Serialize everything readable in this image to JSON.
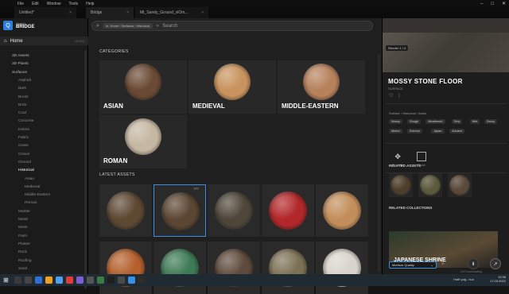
{
  "menu": [
    "File",
    "Edit",
    "Window",
    "Tools",
    "Help"
  ],
  "tabs": [
    {
      "label": "Untitled*",
      "close": "×"
    },
    {
      "label": "Bridge",
      "close": "×"
    },
    {
      "label": "Mt_Sandy_Ground_vlOm...",
      "close": "×"
    }
  ],
  "brand": {
    "line1": "Quixel",
    "line2": "BRIDGE",
    "icon": "Q"
  },
  "sidebar": {
    "home": "Home",
    "home_count": "15,833",
    "items": [
      {
        "label": "3D Assets",
        "level": "top"
      },
      {
        "label": "3D Plants",
        "level": "top"
      },
      {
        "label": "Surfaces",
        "level": "top-open"
      },
      {
        "label": "Asphalt",
        "level": "sub"
      },
      {
        "label": "Bark",
        "level": "sub"
      },
      {
        "label": "Brush",
        "level": "sub"
      },
      {
        "label": "Brick",
        "level": "sub"
      },
      {
        "label": "Coal",
        "level": "sub"
      },
      {
        "label": "Concrete",
        "level": "sub"
      },
      {
        "label": "Debris",
        "level": "sub"
      },
      {
        "label": "Fabric",
        "level": "sub"
      },
      {
        "label": "Grass",
        "level": "sub"
      },
      {
        "label": "Gravel",
        "level": "sub"
      },
      {
        "label": "Ground",
        "level": "sub"
      },
      {
        "label": "Historical",
        "level": "selected"
      },
      {
        "label": "Asian",
        "level": "sub2"
      },
      {
        "label": "Medieval",
        "level": "sub2"
      },
      {
        "label": "Middle-Eastern",
        "level": "sub2"
      },
      {
        "label": "Roman",
        "level": "sub2"
      },
      {
        "label": "Marble",
        "level": "sub"
      },
      {
        "label": "Metal",
        "level": "sub"
      },
      {
        "label": "Moss",
        "level": "sub"
      },
      {
        "label": "Paint",
        "level": "sub"
      },
      {
        "label": "Plaster",
        "level": "sub"
      },
      {
        "label": "Rock",
        "level": "sub"
      },
      {
        "label": "Roofing",
        "level": "sub"
      },
      {
        "label": "Sand",
        "level": "sub"
      }
    ]
  },
  "search": {
    "breadcrumb": "In: Home / Surfaces / Historical",
    "placeholder": "Search"
  },
  "categories_title": "CATEGORIES",
  "categories": [
    {
      "label": "ASIAN",
      "color": "#6a4a34"
    },
    {
      "label": "MEDIEVAL",
      "color": "#c8935e"
    },
    {
      "label": "MIDDLE-EASTERN",
      "color": "#b6825c"
    },
    {
      "label": "ROMAN",
      "color": "#c5b7a2"
    }
  ],
  "latest_title": "LATEST ASSETS",
  "assets": [
    {
      "color": "#5d4832",
      "badge": ""
    },
    {
      "color": "#5a4632",
      "badge": "FFT"
    },
    {
      "color": "#4e4639",
      "badge": ""
    },
    {
      "color": "#b2282a",
      "badge": ""
    },
    {
      "color": "#c38e5b",
      "badge": ""
    },
    {
      "color": "#b45f2c",
      "badge": ""
    },
    {
      "color": "#3e7a55",
      "badge": ""
    },
    {
      "color": "#5e4a3c",
      "badge": ""
    },
    {
      "color": "#7d7155",
      "badge": ""
    },
    {
      "color": "#d8d4cc",
      "badge": ""
    }
  ],
  "detail": {
    "render_label": "Render 1 / 4",
    "title": "MOSSY STONE FLOOR",
    "subtitle": "SURFACE",
    "breadcrumb": "Surface  ›  Historical  ›  Asian",
    "tags": [
      "Mossy",
      "Rough",
      "Weathered",
      "Dirty",
      "Wet",
      "Damp",
      "Muted",
      "Exterior",
      "Japan",
      "Ancient"
    ],
    "actions": [
      {
        "label": "Plan 2D",
        "icon": "✥"
      },
      {
        "label": "Scale",
        "icon": "□"
      }
    ],
    "related_assets_title": "RELATED ASSETS",
    "related": [
      {
        "color": "#4d3e2c"
      },
      {
        "color": "#5c5a3e"
      },
      {
        "color": "#5a4a3a"
      }
    ],
    "related_collections_title": "RELATED COLLECTIONS",
    "collection": "JAPANESE SHRINE",
    "quality": "Medium Quality",
    "download_label": "Ctrl Downloading"
  },
  "taskbar": {
    "time": "13:36",
    "date": "17.03.2022",
    "tray_text": "Hafif yağ...hun"
  }
}
